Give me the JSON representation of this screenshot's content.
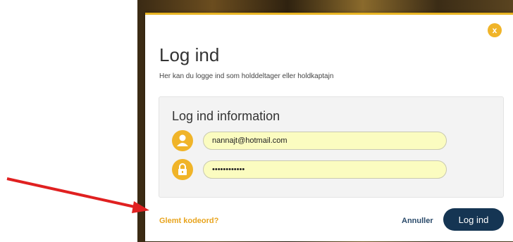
{
  "dialog": {
    "close_label": "x",
    "title": "Log ind",
    "subtitle": "Her kan du logge ind som holddeltager eller holdkaptajn"
  },
  "panel": {
    "title": "Log ind information",
    "username_value": "nannajt@hotmail.com",
    "password_value": "••••••••••••"
  },
  "footer": {
    "forgot_label": "Glemt kodeord?",
    "cancel_label": "Annuller",
    "login_label": "Log ind"
  },
  "colors": {
    "accent": "#f0b429",
    "primary_button": "#153553",
    "input_fill": "#fbfcc0",
    "annotation_arrow": "#e02020"
  }
}
